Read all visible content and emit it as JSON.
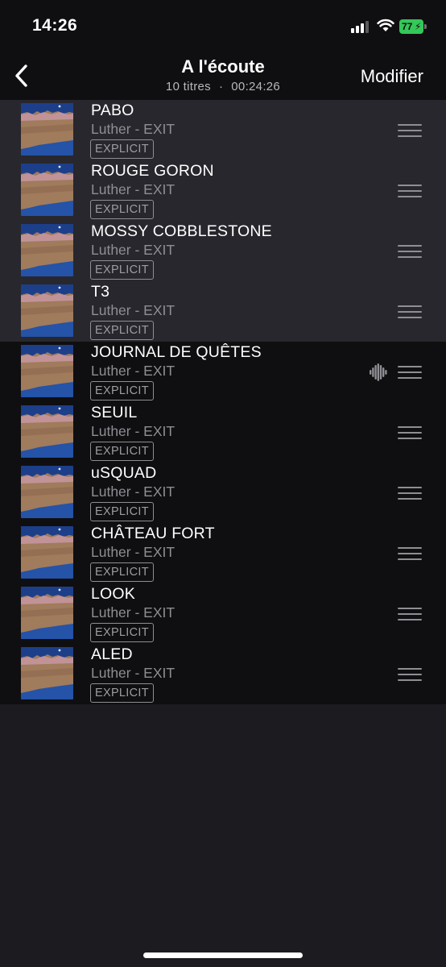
{
  "status_bar": {
    "time": "14:26",
    "battery_percent": "77",
    "signal_bars_filled": 3,
    "signal_bars_total": 4
  },
  "nav": {
    "back_icon": "chevron-left-icon",
    "title": "A l'écoute",
    "track_count": "10 titres",
    "separator": "·",
    "total_duration": "00:24:26",
    "edit_label": "Modifier"
  },
  "colors": {
    "background": "#1c1b20",
    "bar_background": "#0f0f11",
    "played_row": "#28272d",
    "secondary_text": "#8e8e93",
    "battery_green": "#34c759"
  },
  "tracks": [
    {
      "title": "PABO",
      "artist": "Luther - EXIT",
      "badge": "EXPLICIT",
      "state": "played"
    },
    {
      "title": "ROUGE GORON",
      "artist": "Luther - EXIT",
      "badge": "EXPLICIT",
      "state": "played"
    },
    {
      "title": "MOSSY COBBLESTONE",
      "artist": "Luther - EXIT",
      "badge": "EXPLICIT",
      "state": "played"
    },
    {
      "title": "T3",
      "artist": "Luther - EXIT",
      "badge": "EXPLICIT",
      "state": "played"
    },
    {
      "title": "JOURNAL DE QUÊTES",
      "artist": "Luther - EXIT",
      "badge": "EXPLICIT",
      "state": "playing"
    },
    {
      "title": "SEUIL",
      "artist": "Luther - EXIT",
      "badge": "EXPLICIT",
      "state": "upcoming"
    },
    {
      "title": "uSQUAD",
      "artist": "Luther - EXIT",
      "badge": "EXPLICIT",
      "state": "upcoming"
    },
    {
      "title": "CHÂTEAU FORT",
      "artist": "Luther - EXIT",
      "badge": "EXPLICIT",
      "state": "upcoming"
    },
    {
      "title": "LOOK",
      "artist": "Luther - EXIT",
      "badge": "EXPLICIT",
      "state": "upcoming"
    },
    {
      "title": "ALED",
      "artist": "Luther - EXIT",
      "badge": "EXPLICIT",
      "state": "upcoming"
    }
  ]
}
